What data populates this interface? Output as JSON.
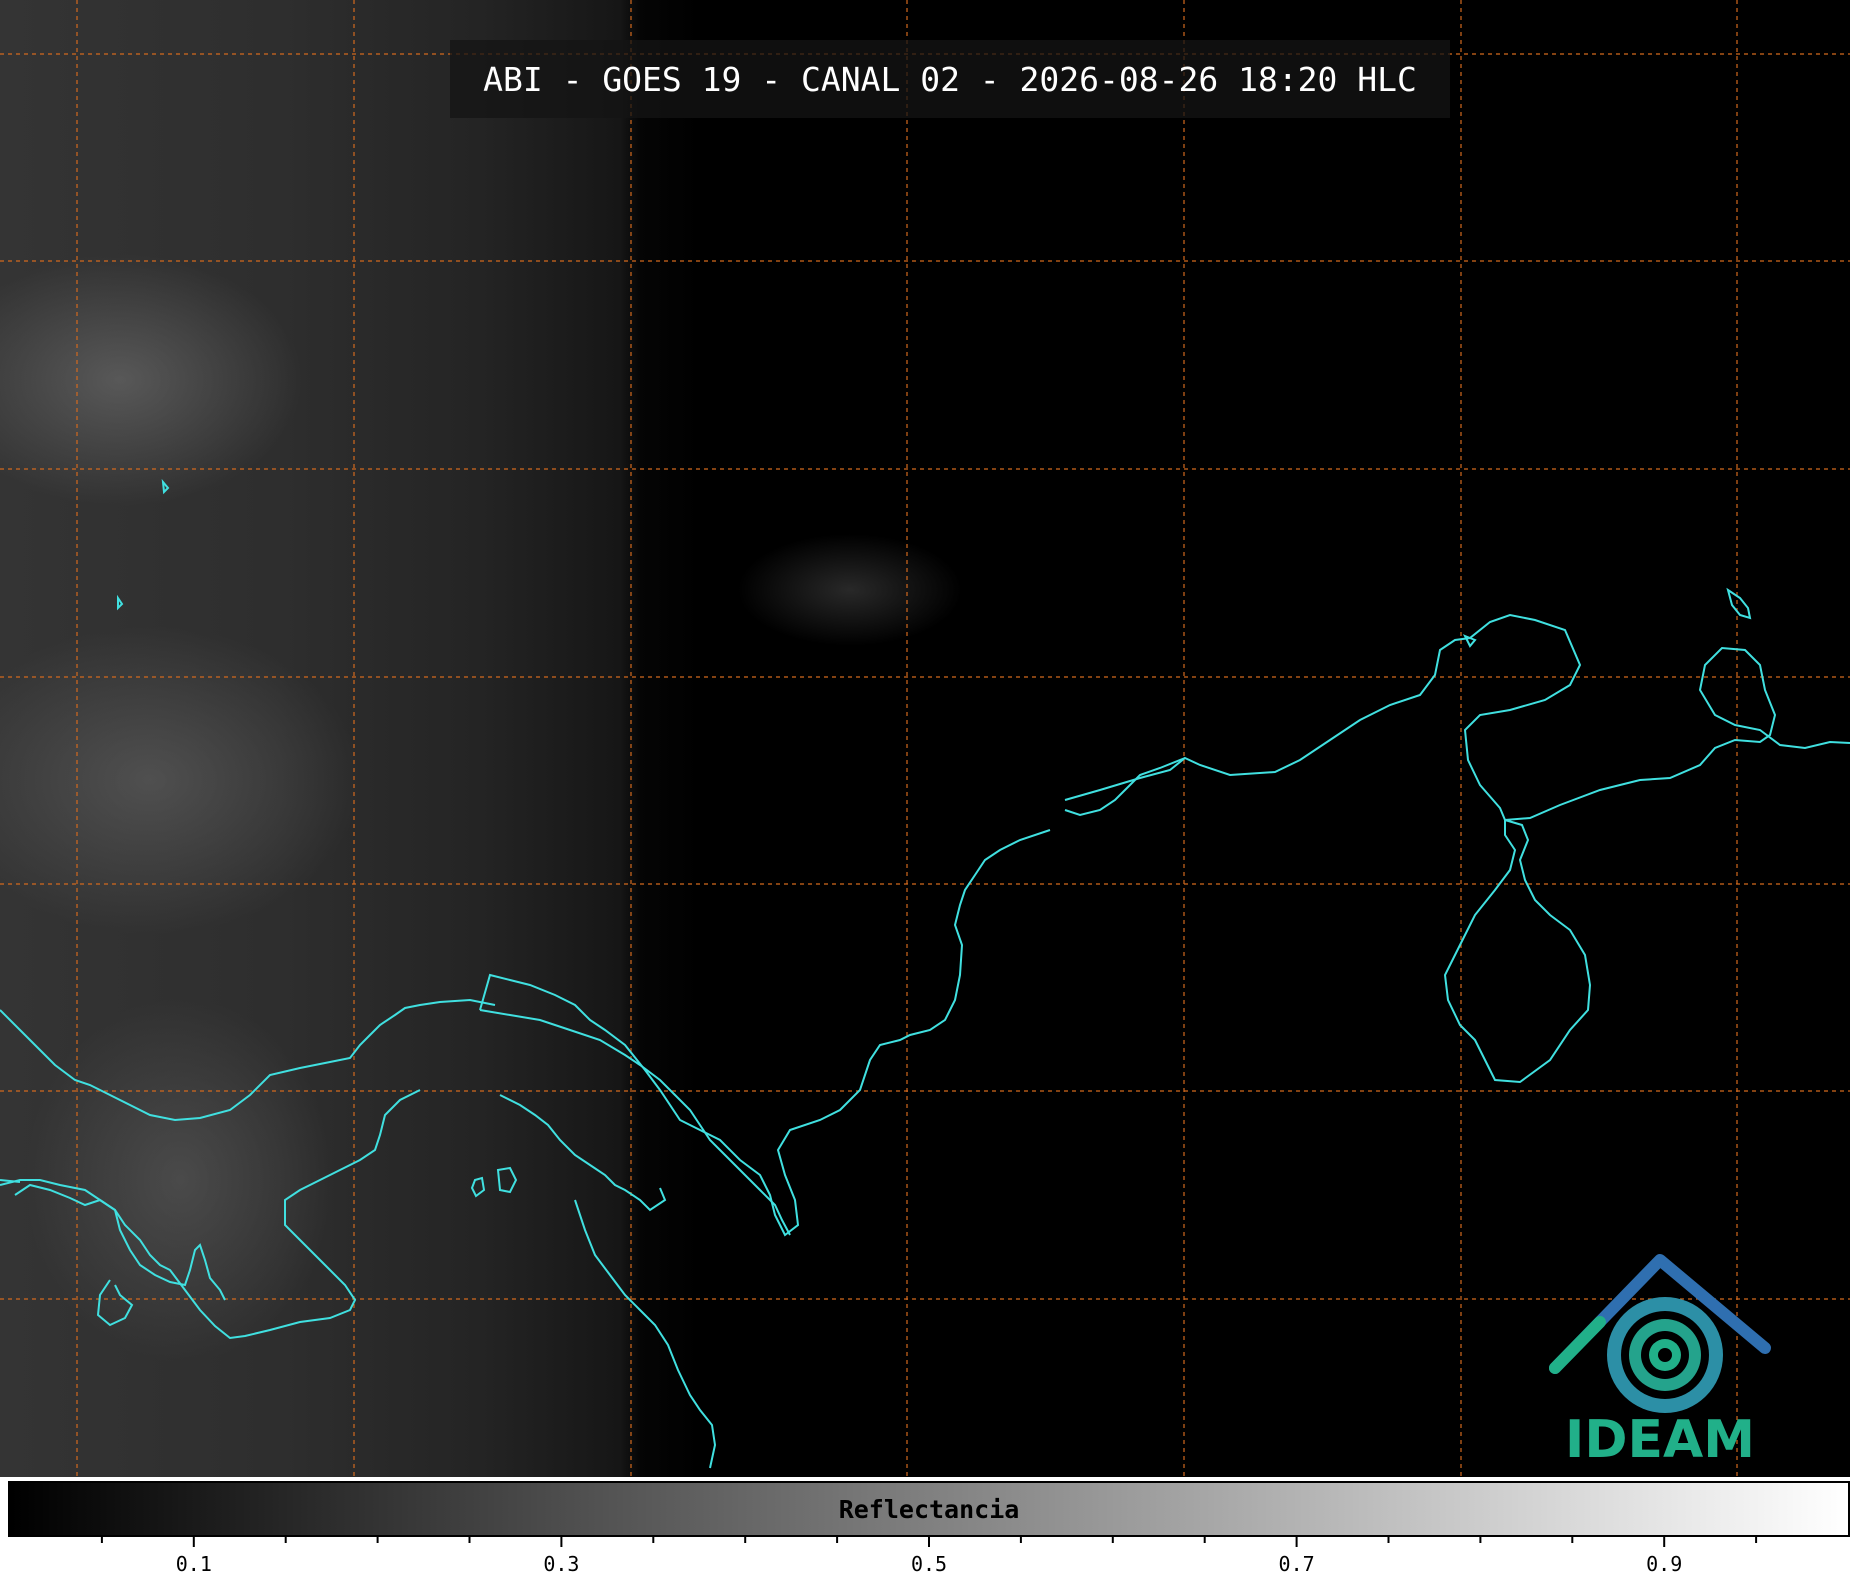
{
  "title": "ABI - GOES 19 - CANAL 02 - 2026-08-26 18:20 HLC",
  "colorbar": {
    "label": "Reflectancia",
    "min": 0.0,
    "max": 1.0,
    "major_ticks": [
      "0.1",
      "0.3",
      "0.5",
      "0.7",
      "0.9"
    ],
    "major_tick_values": [
      0.1,
      0.3,
      0.5,
      0.7,
      0.9
    ],
    "minor_tick_values": [
      0.05,
      0.15,
      0.2,
      0.25,
      0.35,
      0.4,
      0.45,
      0.55,
      0.6,
      0.65,
      0.75,
      0.8,
      0.85,
      0.95
    ]
  },
  "logo": {
    "text": "IDEAM"
  },
  "colors": {
    "coastline": "#40e0e0",
    "grid": "#d2691e",
    "logo_green": "#21b089",
    "logo_blue": "#2f6fb0"
  }
}
